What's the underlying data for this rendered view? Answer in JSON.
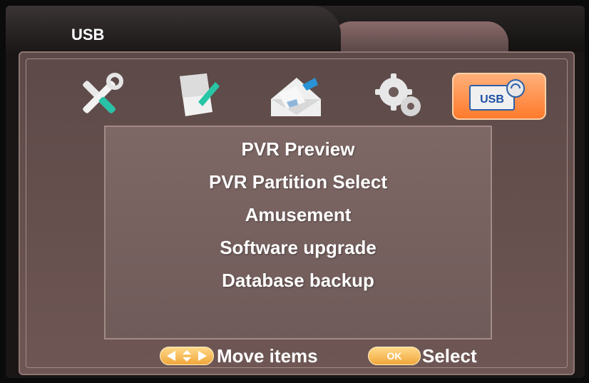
{
  "window": {
    "title": "USB"
  },
  "icons": [
    {
      "name": "tools-icon"
    },
    {
      "name": "edit-document-icon"
    },
    {
      "name": "network-envelope-icon"
    },
    {
      "name": "settings-gears-icon"
    },
    {
      "name": "usb-icon",
      "label": "USB",
      "selected": true
    }
  ],
  "menu": {
    "items": [
      {
        "label": "PVR Preview"
      },
      {
        "label": "PVR Partition Select"
      },
      {
        "label": "Amusement"
      },
      {
        "label": "Software upgrade"
      },
      {
        "label": "Database backup"
      }
    ]
  },
  "footer": {
    "move_label": "Move items",
    "ok_key": "OK",
    "select_label": "Select"
  },
  "colors": {
    "panel_bg": "#7e6866",
    "selected_tile": "#ff7a2c",
    "hint_pill": "#f0a63a"
  }
}
